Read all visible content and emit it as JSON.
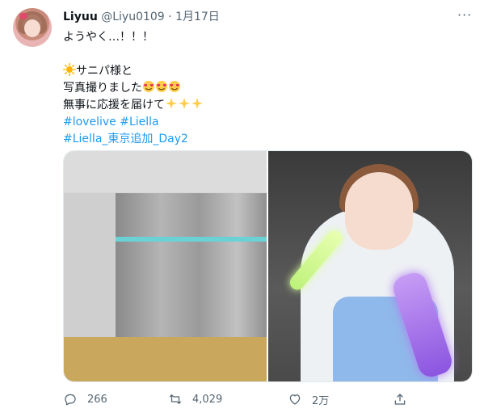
{
  "tweet": {
    "display_name": "Liyuu",
    "handle": "@Liyu0109",
    "separator": "·",
    "date": "1月17日",
    "more": "···",
    "lines": [
      "ようやく…！！！",
      "",
      "サニパ様と",
      "写真撮りました",
      "無事に応援を届けて"
    ],
    "hashtags": [
      "#lovelive #Liella",
      "#Liella_東京追加_Day2"
    ]
  },
  "emojis": {
    "sun": "sun-emoji",
    "heart_eyes": "heart-eyes-emoji",
    "sparkles": "sparkles-emoji"
  },
  "actions": {
    "reply_count": "266",
    "retweet_count": "4,029",
    "like_count": "2万"
  },
  "colors": {
    "accent": "#1d9bf0",
    "muted": "#536471",
    "text": "#0f1419"
  }
}
